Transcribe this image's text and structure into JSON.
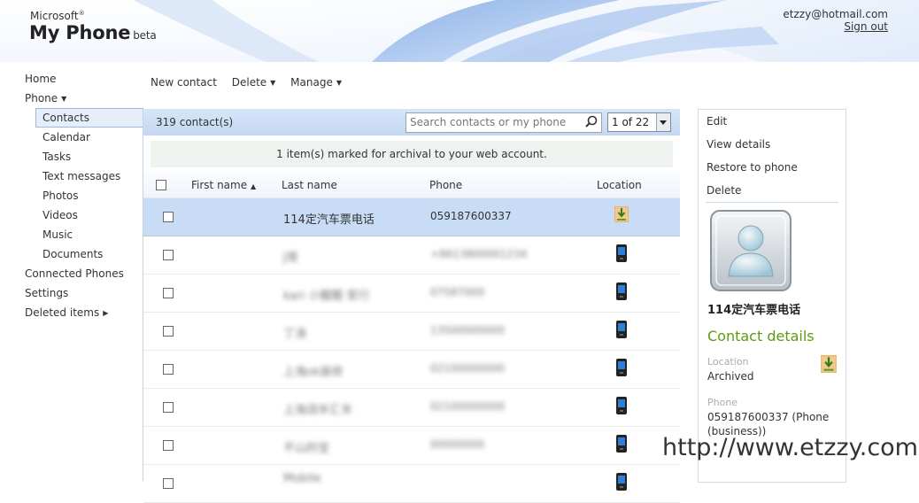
{
  "header": {
    "brand_microsoft": "Microsoft",
    "brand_product": "My Phone",
    "brand_beta": "beta",
    "user_email": "etzzy@hotmail.com",
    "signout_label": "Sign out"
  },
  "sidebar": {
    "items": [
      {
        "label": "Home"
      },
      {
        "label": "Phone"
      },
      {
        "label": "Contacts",
        "selected": true
      },
      {
        "label": "Calendar"
      },
      {
        "label": "Tasks"
      },
      {
        "label": "Text messages"
      },
      {
        "label": "Photos"
      },
      {
        "label": "Videos"
      },
      {
        "label": "Music"
      },
      {
        "label": "Documents"
      },
      {
        "label": "Connected Phones"
      },
      {
        "label": "Settings"
      },
      {
        "label": "Deleted items"
      }
    ]
  },
  "toolbar": {
    "new_contact": "New contact",
    "delete": "Delete",
    "manage": "Manage"
  },
  "list": {
    "count_text": "319 contact(s)",
    "search_placeholder": "Search contacts or my phone",
    "pager_text": "1 of 22",
    "notice": "1 item(s) marked for archival to your web account.",
    "columns": {
      "first_name": "First name",
      "last_name": "Last name",
      "phone": "Phone",
      "location": "Location"
    },
    "rows": [
      {
        "last_name": "114定汽车票电话",
        "phone": "059187600337",
        "location_icon": "archive-icon",
        "selected": true
      },
      {
        "last_name": "J哥",
        "phone": "+8613800001234",
        "location_icon": "phone-icon"
      },
      {
        "last_name": "kari 小醒醒 家行",
        "phone": "07587000",
        "location_icon": "phone-icon"
      },
      {
        "last_name": "丁涛",
        "phone": "13500000000",
        "location_icon": "phone-icon"
      },
      {
        "last_name": "上海ok装修",
        "phone": "02100000000",
        "location_icon": "phone-icon"
      },
      {
        "last_name": "上海润丰汇丰",
        "phone": "02100000000",
        "location_icon": "phone-icon"
      },
      {
        "last_name": "不山的宝",
        "phone": "00000000",
        "location_icon": "phone-icon"
      },
      {
        "last_name": "Mobile",
        "phone": "",
        "location_icon": "phone-icon"
      }
    ]
  },
  "details": {
    "actions": {
      "edit": "Edit",
      "view": "View details",
      "restore": "Restore to phone",
      "delete": "Delete"
    },
    "name": "114定汽车票电话",
    "section_title": "Contact details",
    "location_label": "Location",
    "location_value": "Archived",
    "phone_label": "Phone",
    "phone_value": "059187600337 (Phone (business))"
  },
  "watermark": "http://www.etzzy.com",
  "colors": {
    "accent_green": "#5c9c10",
    "header_blue": "#c4d8f3",
    "selected_row": "#c9dcf5"
  }
}
